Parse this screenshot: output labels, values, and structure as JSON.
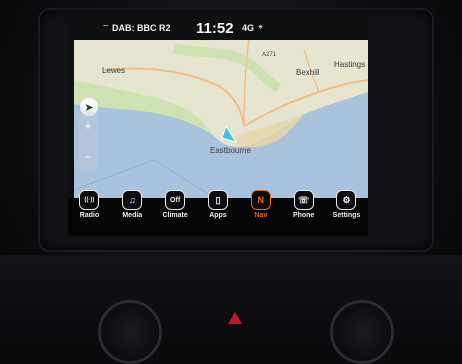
{
  "status_bar": {
    "radio": "DAB: BBC R2",
    "time": "11:52",
    "network": "4G"
  },
  "map": {
    "places": {
      "lewes": "Lewes",
      "bexhill": "Bexhill",
      "hastings": "Hastings",
      "eastbourne": "Eastbourne",
      "road": "A271"
    },
    "colors": {
      "land": "#e6e6d0",
      "sea": "#a9c3df",
      "green": "#cfe2b4",
      "road": "#f0c08a"
    }
  },
  "dock": {
    "items": [
      {
        "label": "Radio",
        "icon": "radio-icon",
        "glyph": "((·))"
      },
      {
        "label": "Media",
        "icon": "music-note-icon",
        "glyph": "♫"
      },
      {
        "label": "Climate",
        "icon": "climate-off-icon",
        "glyph": "Off"
      },
      {
        "label": "Apps",
        "icon": "apps-icon",
        "glyph": "▯"
      },
      {
        "label": "Nav",
        "icon": "nav-compass-icon",
        "glyph": "N"
      },
      {
        "label": "Phone",
        "icon": "phone-icon",
        "glyph": "☏"
      },
      {
        "label": "Settings",
        "icon": "settings-gear-icon",
        "glyph": "⚙"
      }
    ],
    "active": "Nav",
    "accent": "#e2682a"
  }
}
